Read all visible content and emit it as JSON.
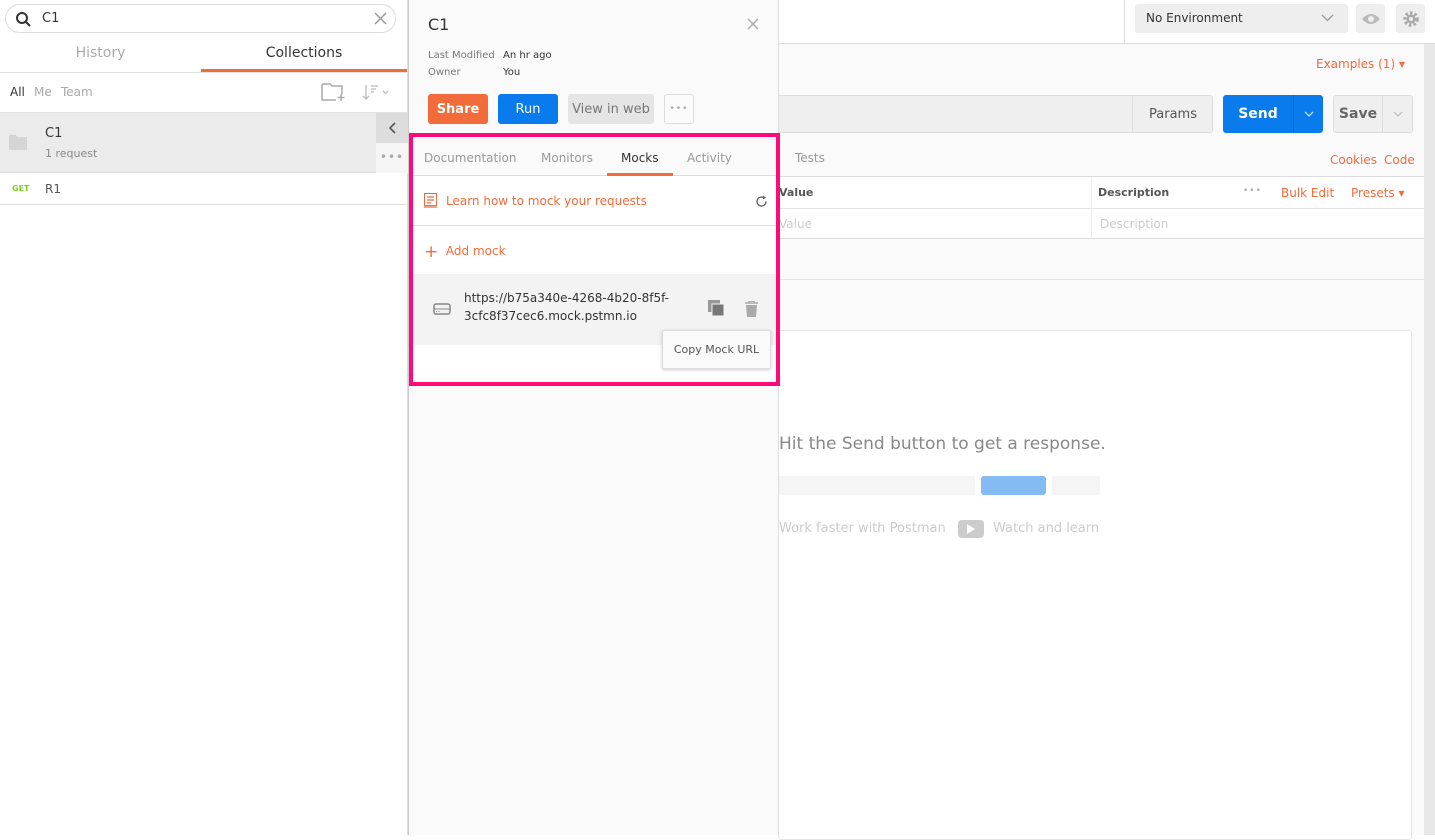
{
  "sidebar": {
    "search_value": "C1",
    "tabs": [
      {
        "label": "History"
      },
      {
        "label": "Collections",
        "active": true
      }
    ],
    "filters": [
      "All",
      "Me",
      "Team"
    ],
    "collection": {
      "name": "C1",
      "meta": "1 request"
    },
    "requests": [
      {
        "method": "GET",
        "name": "R1"
      }
    ]
  },
  "collection_panel": {
    "title": "C1",
    "last_modified_label": "Last Modified",
    "last_modified": "An hr ago",
    "owner_label": "Owner",
    "owner": "You",
    "share": "Share",
    "run": "Run",
    "view_web": "View in web",
    "tabs": [
      "Documentation",
      "Monitors",
      "Mocks",
      "Activity"
    ],
    "active_tab": "Mocks",
    "learn_link": "Learn how to mock your requests",
    "add_mock": "Add mock",
    "mock_url_line1": "https://b75a340e-4268-4b20-8f5f-",
    "mock_url_line2": "3cfc8f37cec6.mock.pstmn.io",
    "tooltip": "Copy Mock URL"
  },
  "header": {
    "environment": "No Environment"
  },
  "request": {
    "examples": "Examples (1)",
    "params": "Params",
    "send": "Send",
    "save": "Save",
    "tab_tests": "Tests",
    "cookies": "Cookies",
    "code": "Code",
    "table": {
      "value_header": "Value",
      "description_header": "Description",
      "bulk_edit": "Bulk Edit",
      "presets": "Presets",
      "value_placeholder": "Value",
      "description_placeholder": "Description"
    }
  },
  "response": {
    "empty": "Hit the Send button to get a response.",
    "work_faster": "Work faster with Postman",
    "watch": "Watch and learn"
  },
  "colors": {
    "accent": "#f26b3a",
    "primary": "#097bed",
    "highlight": "#ff0a78",
    "get": "#7ed321"
  }
}
